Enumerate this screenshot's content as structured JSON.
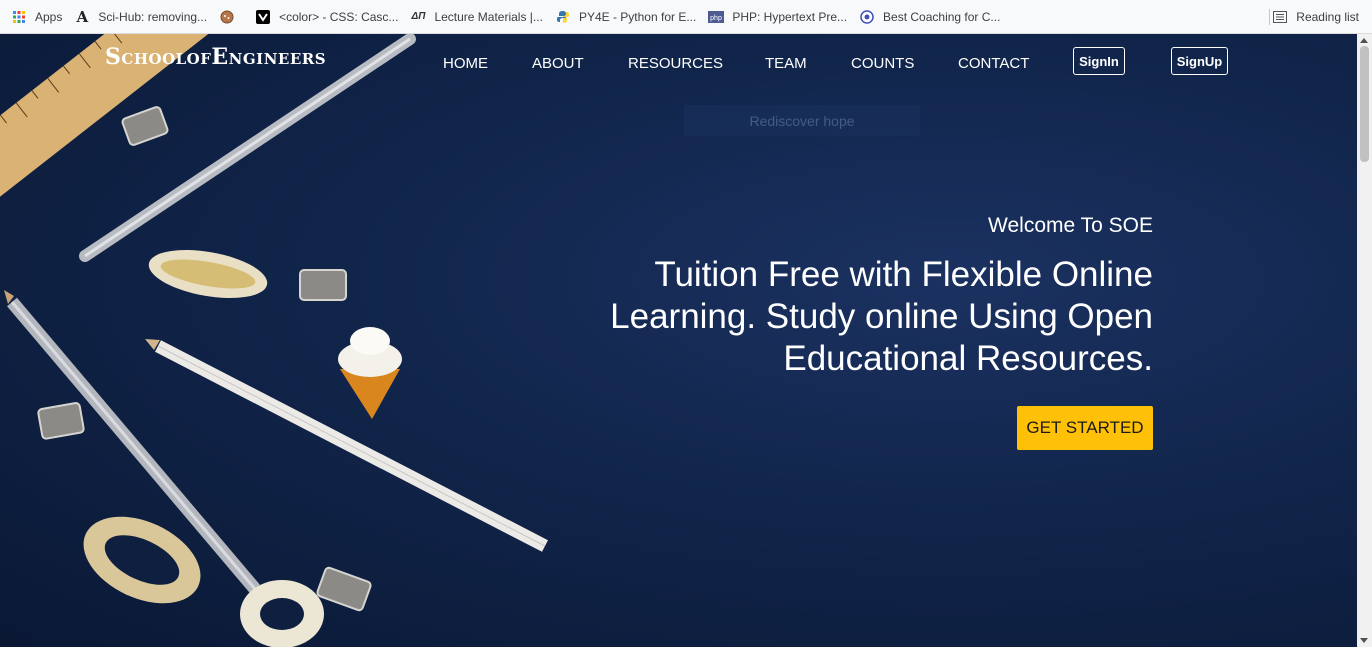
{
  "bookmarks": {
    "items": [
      {
        "label": "Apps",
        "icon": "apps-grid-icon"
      },
      {
        "label": "Sci-Hub: removing...",
        "icon": "sci-hub-icon"
      },
      {
        "label": "",
        "icon": "cookie-icon"
      },
      {
        "label": "<color> - CSS: Casc...",
        "icon": "mdn-icon"
      },
      {
        "label": "Lecture Materials |...",
        "icon": "nptel-icon"
      },
      {
        "label": "PY4E - Python for E...",
        "icon": "python-icon"
      },
      {
        "label": "PHP: Hypertext Pre...",
        "icon": "php-icon"
      },
      {
        "label": "Best Coaching for C...",
        "icon": "coaching-icon"
      }
    ],
    "reading_list": "Reading list"
  },
  "header": {
    "logo": "SchoolofEngineers",
    "nav": [
      "HOME",
      "ABOUT",
      "RESOURCES",
      "TEAM",
      "COUNTS",
      "CONTACT"
    ],
    "signin": "SignIn",
    "signup": "SignUp"
  },
  "hero": {
    "ghost_text": "Rediscover hope",
    "welcome": "Welcome To SOE",
    "headline": "Tuition Free with Flexible Online Learning. Study online Using Open Educational Resources.",
    "cta": "GET STARTED"
  },
  "colors": {
    "accent": "#ffc107",
    "background": "#0e1f3f"
  }
}
